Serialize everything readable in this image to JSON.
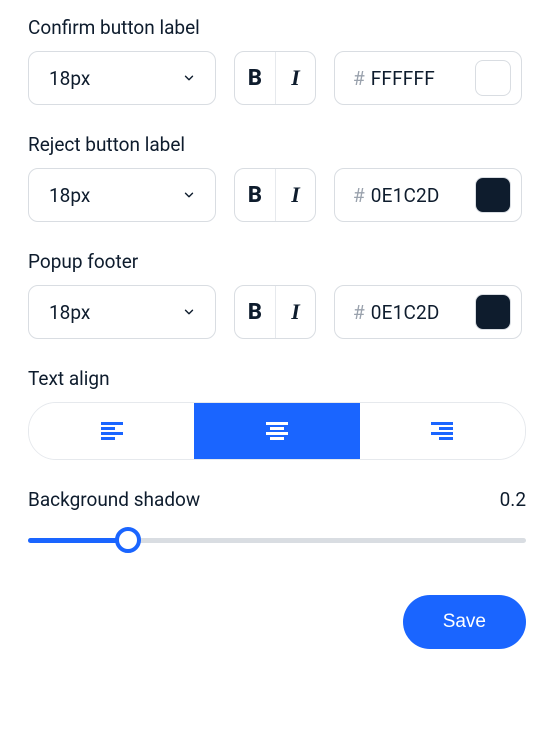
{
  "sections": {
    "confirm": {
      "label": "Confirm button label",
      "fontSize": "18px",
      "colorHex": "FFFFFF",
      "swatch": "#FFFFFF"
    },
    "reject": {
      "label": "Reject button label",
      "fontSize": "18px",
      "colorHex": "0E1C2D",
      "swatch": "#0E1C2D"
    },
    "footer": {
      "label": "Popup footer",
      "fontSize": "18px",
      "colorHex": "0E1C2D",
      "swatch": "#0E1C2D"
    }
  },
  "textAlign": {
    "label": "Text align",
    "selected": "center"
  },
  "shadow": {
    "label": "Background shadow",
    "value": "0.2",
    "percent": 20
  },
  "buttons": {
    "save": "Save"
  },
  "glyphs": {
    "hash": "#",
    "bold": "B",
    "italic": "I"
  }
}
